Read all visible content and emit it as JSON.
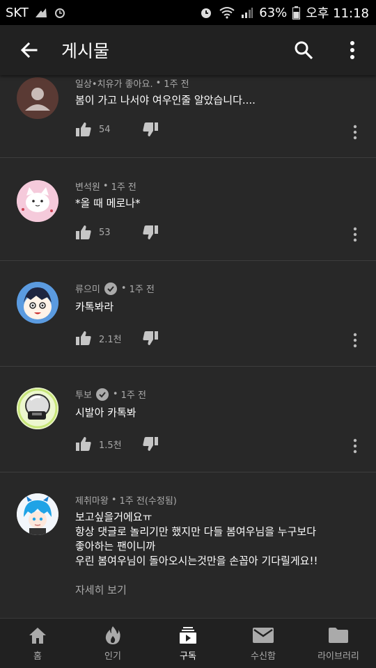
{
  "status_bar": {
    "carrier": "SKT",
    "battery": "63%",
    "time": "오후 11:18"
  },
  "app_bar": {
    "title": "게시물"
  },
  "comments": [
    {
      "author": "일상•치유가 좋아요.",
      "time": "1주 전",
      "verified": false,
      "text_lines": [
        "봄이 가고 나서야 여우인줄 알았습니다...."
      ],
      "likes": "54"
    },
    {
      "author": "변석원",
      "time": "1주 전",
      "verified": false,
      "text_lines": [
        "*올 때 메로나*"
      ],
      "likes": "53"
    },
    {
      "author": "류으미",
      "time": "1주 전",
      "verified": true,
      "text_lines": [
        "카톡봐라"
      ],
      "likes": "2.1천"
    },
    {
      "author": "투보",
      "time": "1주 전",
      "verified": true,
      "text_lines": [
        "시발아 카톡봐"
      ],
      "likes": "1.5천"
    },
    {
      "author": "제취마왕",
      "time": "1주 전(수정됨)",
      "verified": false,
      "text_lines": [
        "보고싶을거에요ㅠ",
        "항상 댓글로 놀리기만 했지만 다들 봄여우님을 누구보다",
        "좋아하는 팬이니까",
        "우린 봄여우님이 돌아오시는것만을 손꼽아 기다릴게요!!"
      ],
      "read_more": "자세히 보기"
    }
  ],
  "bottom_nav": [
    {
      "label": "홈",
      "icon": "home-icon",
      "active": false
    },
    {
      "label": "인기",
      "icon": "fire-icon",
      "active": false
    },
    {
      "label": "구독",
      "icon": "subscriptions-icon",
      "active": true
    },
    {
      "label": "수신함",
      "icon": "mail-icon",
      "active": false
    },
    {
      "label": "라이브러리",
      "icon": "folder-icon",
      "active": false
    }
  ],
  "colors": {
    "background": "#282828",
    "bar": "#212121",
    "secondary_text": "#aaaaaa",
    "divider": "#3d3d3d"
  }
}
